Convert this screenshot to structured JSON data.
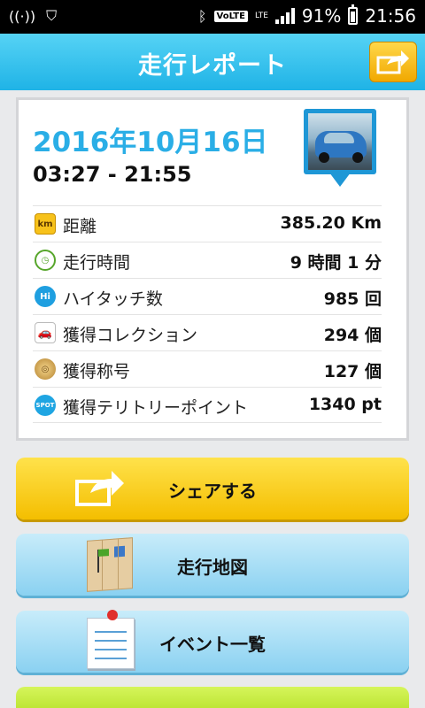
{
  "statusbar": {
    "network_badge": "VoLTE",
    "lte": "LTE",
    "battery": "91%",
    "time": "21:56"
  },
  "header": {
    "title": "走行レポート"
  },
  "report": {
    "date": "2016年10月16日",
    "time_range": "03:27 - 21:55",
    "stats": [
      {
        "label": "距離",
        "value": "385.20 Km",
        "icon": "km-icon",
        "icon_text": "km"
      },
      {
        "label": "走行時間",
        "value": "9 時間 1 分",
        "icon": "clock-icon",
        "icon_text": "◷"
      },
      {
        "label": "ハイタッチ数",
        "value": "985 回",
        "icon": "high-five-icon",
        "icon_text": "Hi"
      },
      {
        "label": "獲得コレクション",
        "value": "294 個",
        "icon": "car-icon",
        "icon_text": "🚗"
      },
      {
        "label": "獲得称号",
        "value": "127 個",
        "icon": "medal-icon",
        "icon_text": "◎"
      },
      {
        "label": "獲得テリトリーポイント",
        "value": "1340 pt",
        "icon": "spot-icon",
        "icon_text": "SPOT"
      }
    ]
  },
  "buttons": {
    "share": "シェアする",
    "map": "走行地図",
    "events": "イベント一覧"
  },
  "colors": {
    "header": "#1fb3e6",
    "date": "#2aaee6",
    "share_button": "#f4be00",
    "nav_button": "#8ad1f1"
  }
}
